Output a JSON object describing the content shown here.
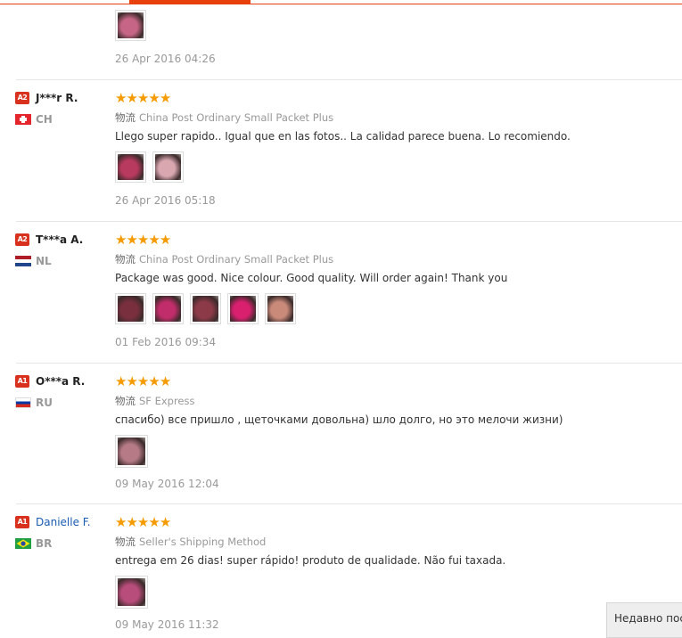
{
  "header": {
    "accent_color": "#e8400c"
  },
  "first_partial": {
    "thumb_colors": [
      "#c66585"
    ],
    "date": "26 Apr 2016 04:26"
  },
  "reviews": [
    {
      "level": "A2",
      "name": "J***r R.",
      "country": "CH",
      "flag": "switzerland-flag-icon",
      "stars": 5,
      "shipping_label": "物流",
      "shipping": "China Post Ordinary Small Packet Plus",
      "text": "Llego super rapido.. Igual que en las fotos.. La calidad parece buena. Lo recomiendo.",
      "thumb_colors": [
        "#b83a5e",
        "#d9a7b0"
      ],
      "date": "26 Apr 2016 05:18"
    },
    {
      "level": "A2",
      "name": "T***a A.",
      "country": "NL",
      "flag": "netherlands-flag-icon",
      "stars": 5,
      "shipping_label": "物流",
      "shipping": "China Post Ordinary Small Packet Plus",
      "text": "Package was good. Nice colour. Good quality. Will order again! Thank you",
      "thumb_colors": [
        "#7a2f3e",
        "#c02d6a",
        "#8c3a48",
        "#d8206e",
        "#c98a7a"
      ],
      "date": "01 Feb 2016 09:34"
    },
    {
      "level": "A1",
      "name": "O***a R.",
      "country": "RU",
      "flag": "russia-flag-icon",
      "stars": 5,
      "shipping_label": "物流",
      "shipping": "SF Express",
      "text": "спасибо) все пришло , щеточками довольна) шло долго, но это мелочи жизни)",
      "thumb_colors": [
        "#b57a86"
      ],
      "date": "09 May 2016 12:04"
    },
    {
      "level": "A1",
      "name": "Danielle F.",
      "country": "BR",
      "flag": "brazil-flag-icon",
      "stars": 5,
      "shipping_label": "物流",
      "shipping": "Seller's Shipping Method",
      "text": "entrega em 26 dias! super rápido! produto de qualidade. Não fui taxada.",
      "thumb_colors": [
        "#b84c7a"
      ],
      "date": "09 May 2016 11:32"
    }
  ],
  "toast": {
    "text": "Недавно пос"
  }
}
